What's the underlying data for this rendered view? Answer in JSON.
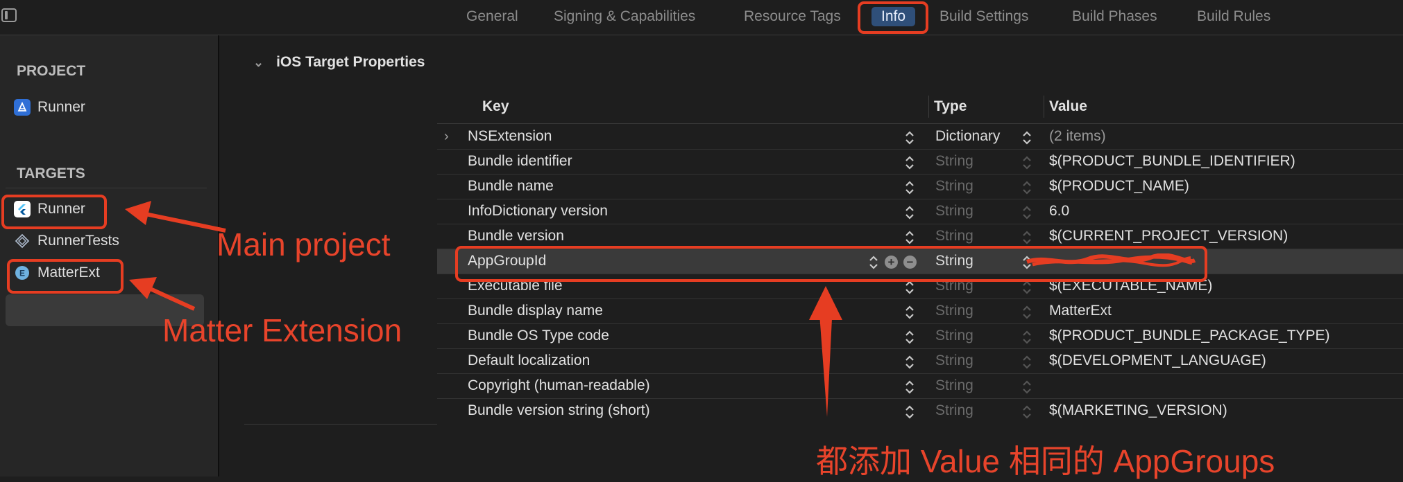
{
  "tabs": [
    {
      "label": "General"
    },
    {
      "label": "Signing & Capabilities"
    },
    {
      "label": "Resource Tags"
    },
    {
      "label": "Info"
    },
    {
      "label": "Build Settings"
    },
    {
      "label": "Build Phases"
    },
    {
      "label": "Build Rules"
    }
  ],
  "sidebar": {
    "project_header": "PROJECT",
    "project_item": "Runner",
    "targets_header": "TARGETS",
    "targets": [
      {
        "label": "Runner",
        "icon": "flutter-icon"
      },
      {
        "label": "RunnerTests",
        "icon": "test-bundle-icon"
      },
      {
        "label": "MatterExt",
        "icon": "extension-icon"
      }
    ]
  },
  "section": {
    "title": "iOS Target Properties"
  },
  "table": {
    "headers": {
      "key": "Key",
      "type": "Type",
      "value": "Value"
    },
    "rows": [
      {
        "key": "NSExtension",
        "type": "Dictionary",
        "value": "(2 items)"
      },
      {
        "key": "Bundle identifier",
        "type": "String",
        "value": "$(PRODUCT_BUNDLE_IDENTIFIER)"
      },
      {
        "key": "Bundle name",
        "type": "String",
        "value": "$(PRODUCT_NAME)"
      },
      {
        "key": "InfoDictionary version",
        "type": "String",
        "value": "6.0"
      },
      {
        "key": "Bundle version",
        "type": "String",
        "value": "$(CURRENT_PROJECT_VERSION)"
      },
      {
        "key": "AppGroupId",
        "type": "String",
        "value": ""
      },
      {
        "key": "Executable file",
        "type": "String",
        "value": "$(EXECUTABLE_NAME)"
      },
      {
        "key": "Bundle display name",
        "type": "String",
        "value": "MatterExt"
      },
      {
        "key": "Bundle OS Type code",
        "type": "String",
        "value": "$(PRODUCT_BUNDLE_PACKAGE_TYPE)"
      },
      {
        "key": "Default localization",
        "type": "String",
        "value": "$(DEVELOPMENT_LANGUAGE)"
      },
      {
        "key": "Copyright (human-readable)",
        "type": "String",
        "value": ""
      },
      {
        "key": "Bundle version string (short)",
        "type": "String",
        "value": "$(MARKETING_VERSION)"
      }
    ]
  },
  "annotations": {
    "main_project": "Main project",
    "matter_extension": "Matter Extension",
    "note": "都添加 Value 相同的 AppGroups"
  },
  "colors": {
    "annotation_red": "#e63d22",
    "active_tab": "#2f4f79",
    "background": "#1e1e1e",
    "sidebar": "#262626"
  }
}
